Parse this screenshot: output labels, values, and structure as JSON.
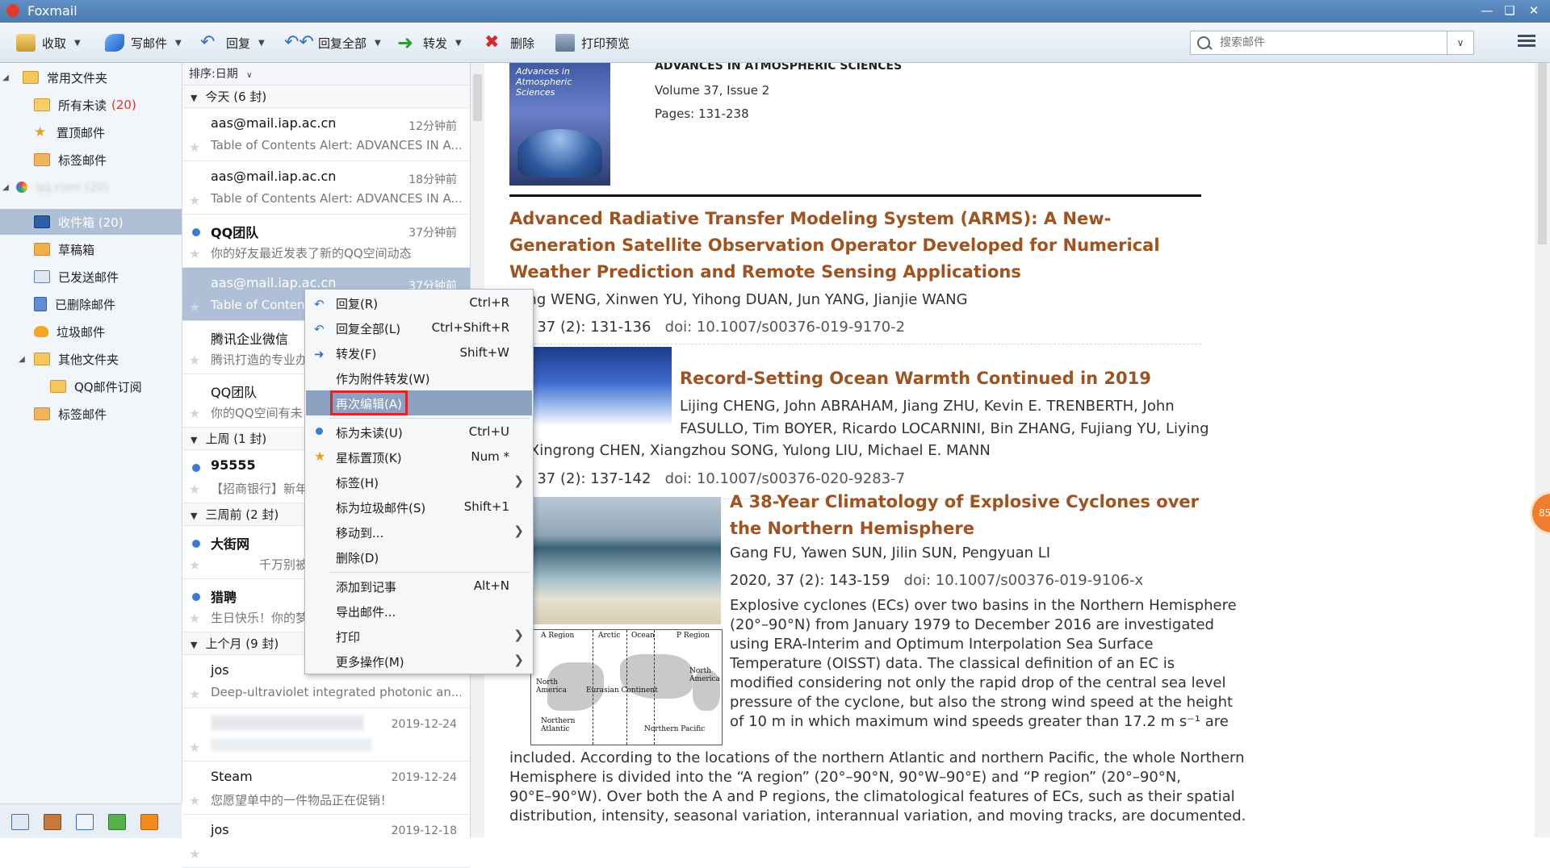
{
  "window": {
    "title": "Foxmail"
  },
  "toolbar": {
    "receive": "收取",
    "compose": "写邮件",
    "reply": "回复",
    "reply_all": "回复全部",
    "forward": "转发",
    "delete": "删除",
    "print_preview": "打印预览",
    "search_placeholder": "搜索邮件"
  },
  "folders": {
    "common": "常用文件夹",
    "all_unread": "所有未读",
    "all_unread_count": "(20)",
    "pinned": "置顶邮件",
    "tagged": "标签邮件",
    "account_blurred": "qq.com (20)",
    "inbox": "收件箱 (20)",
    "drafts": "草稿箱",
    "sent": "已发送邮件",
    "deleted": "已删除邮件",
    "junk": "垃圾邮件",
    "other": "其他文件夹",
    "qq_subscribe": "QQ邮件订阅",
    "tagged2": "标签邮件"
  },
  "maillist": {
    "sort_label": "排序:日期",
    "groups": {
      "today": "今天 (6 封)",
      "last_week": "上周 (1 封)",
      "three_weeks": "三周前 (2 封)",
      "last_month": "上个月 (9 封)"
    },
    "mails": [
      {
        "sender": "aas@mail.iap.ac.cn",
        "time": "12分钟前",
        "subject": "Table of Contents Alert: ADVANCES IN A..."
      },
      {
        "sender": "aas@mail.iap.ac.cn",
        "time": "18分钟前",
        "subject": "Table of Contents Alert: ADVANCES IN A..."
      },
      {
        "sender": "QQ团队",
        "time": "37分钟前",
        "subject": "你的好友最近发表了新的QQ空间动态"
      },
      {
        "sender": "aas@mail.iap.ac.cn",
        "time": "37分钟前",
        "subject": "Table of Contents Alert: ADVANCES IN A..."
      },
      {
        "sender": "腾讯企业微信",
        "time": "",
        "subject": "腾讯打造的专业办"
      },
      {
        "sender": "QQ团队",
        "time": "",
        "subject": "你的QQ空间有未"
      },
      {
        "sender": "95555",
        "time": "",
        "subject": "【招商银行】新年"
      },
      {
        "sender": "大街网",
        "time": "",
        "subject": "千万别被"
      },
      {
        "sender": "猎聘",
        "time": "",
        "subject": "生日快乐！你的梦"
      },
      {
        "sender": "jos",
        "time": "",
        "subject": "Deep-ultraviolet integrated photonic an..."
      },
      {
        "sender": "",
        "time": "2019-12-24",
        "subject": ""
      },
      {
        "sender": "Steam",
        "time": "2019-12-24",
        "subject": "您愿望单中的一件物品正在促销！"
      },
      {
        "sender": "jos",
        "time": "2019-12-18",
        "subject": ""
      }
    ]
  },
  "context_menu": [
    {
      "label": "回复(R)",
      "shortcut": "Ctrl+R"
    },
    {
      "label": "回复全部(L)",
      "shortcut": "Ctrl+Shift+R"
    },
    {
      "label": "转发(F)",
      "shortcut": "Shift+W"
    },
    {
      "label": "作为附件转发(W)",
      "shortcut": ""
    },
    {
      "label": "再次编辑(A)",
      "shortcut": ""
    },
    {
      "label": "标为未读(U)",
      "shortcut": "Ctrl+U"
    },
    {
      "label": "星标置顶(K)",
      "shortcut": "Num *"
    },
    {
      "label": "标签(H)",
      "shortcut": ""
    },
    {
      "label": "标为垃圾邮件(S)",
      "shortcut": "Shift+1"
    },
    {
      "label": "移动到...",
      "shortcut": ""
    },
    {
      "label": "删除(D)",
      "shortcut": ""
    },
    {
      "label": "添加到记事",
      "shortcut": "Alt+N"
    },
    {
      "label": "导出邮件...",
      "shortcut": ""
    },
    {
      "label": "打印",
      "shortcut": ""
    },
    {
      "label": "更多操作(M)",
      "shortcut": ""
    }
  ],
  "reading": {
    "journal_cover_text": "Advances in Atmospheric Sciences",
    "journal_name": "ADVANCES IN ATMOSPHERIC SCIENCES",
    "volume": "Volume 37, Issue 2",
    "pages": "Pages: 131-238",
    "articles": [
      {
        "title": "Advanced Radiative Transfer Modeling System (ARMS): A New-Generation Satellite Observation Operator Developed for Numerical Weather Prediction and Remote Sensing Applications",
        "authors": "hong WENG, Xinwen YU, Yihong DUAN, Jun YANG, Jianjie WANG",
        "cite": "20, 37 (2): 131-136",
        "doi": "doi: 10.1007/s00376-019-9170-2"
      },
      {
        "title": "Record-Setting Ocean Warmth Continued in 2019",
        "authors_1": "Lijing CHENG, John ABRAHAM, Jiang ZHU, Kevin E. TRENBERTH, John",
        "authors_2": "FASULLO, Tim BOYER, Ricardo LOCARNINI, Bin ZHANG, Fujiang YU, Liying",
        "authors_3": "N, Xingrong CHEN, Xiangzhou SONG, Yulong LIU, Michael E. MANN",
        "cite": "20, 37 (2): 137-142",
        "doi": "doi: 10.1007/s00376-020-9283-7"
      },
      {
        "title": "A 38-Year Climatology of Explosive Cyclones over the Northern Hemisphere",
        "authors": "Gang FU, Yawen SUN, Jilin SUN, Pengyuan LI",
        "cite": "2020, 37 (2): 143-159",
        "doi": "doi: 10.1007/s00376-019-9106-x",
        "abstract_1": "Explosive cyclones (ECs) over two basins in the Northern Hemisphere",
        "abstract_2": "(20°–90°N) from January 1979 to December 2016 are investigated",
        "abstract_3": "using ERA-Interim and Optimum Interpolation Sea Surface",
        "abstract_4": "Temperature (OISST) data. The classical definition of an EC is",
        "abstract_5": "modified considering not only the rapid drop of the central sea level",
        "abstract_6": "pressure of the cyclone, but also the strong wind speed at the height",
        "abstract_7": "of 10 m in which maximum wind speeds greater than 17.2 m s⁻¹ are",
        "abstract_8": "included. According to the locations of the northern Atlantic and northern Pacific, the whole Northern",
        "abstract_9": "Hemisphere is divided into the “A region” (20°–90°N, 90°W–90°E) and “P region” (20°–90°N,",
        "abstract_10": "90°E–90°W). Over both the A and P regions, the climatological features of ECs, such as their spatial",
        "abstract_11": "distribution, intensity, seasonal variation, interannual variation, and moving tracks, are documented."
      }
    ],
    "map_labels": {
      "a_region": "A Region",
      "arctic": "Arctic",
      "ocean": "Ocean",
      "p_region": "P Region",
      "north_america": "North America",
      "eurasian": "Eurasian Continent",
      "north_america_2": "North America",
      "n_atlantic": "Northern Atlantic",
      "n_pacific": "Northern Pacific"
    },
    "badge": "85"
  },
  "colors": {
    "accent_blue": "#5f8fc4",
    "title_orange": "#a0521f",
    "unread_red": "#e0342b",
    "highlight_red": "#d8262a"
  }
}
